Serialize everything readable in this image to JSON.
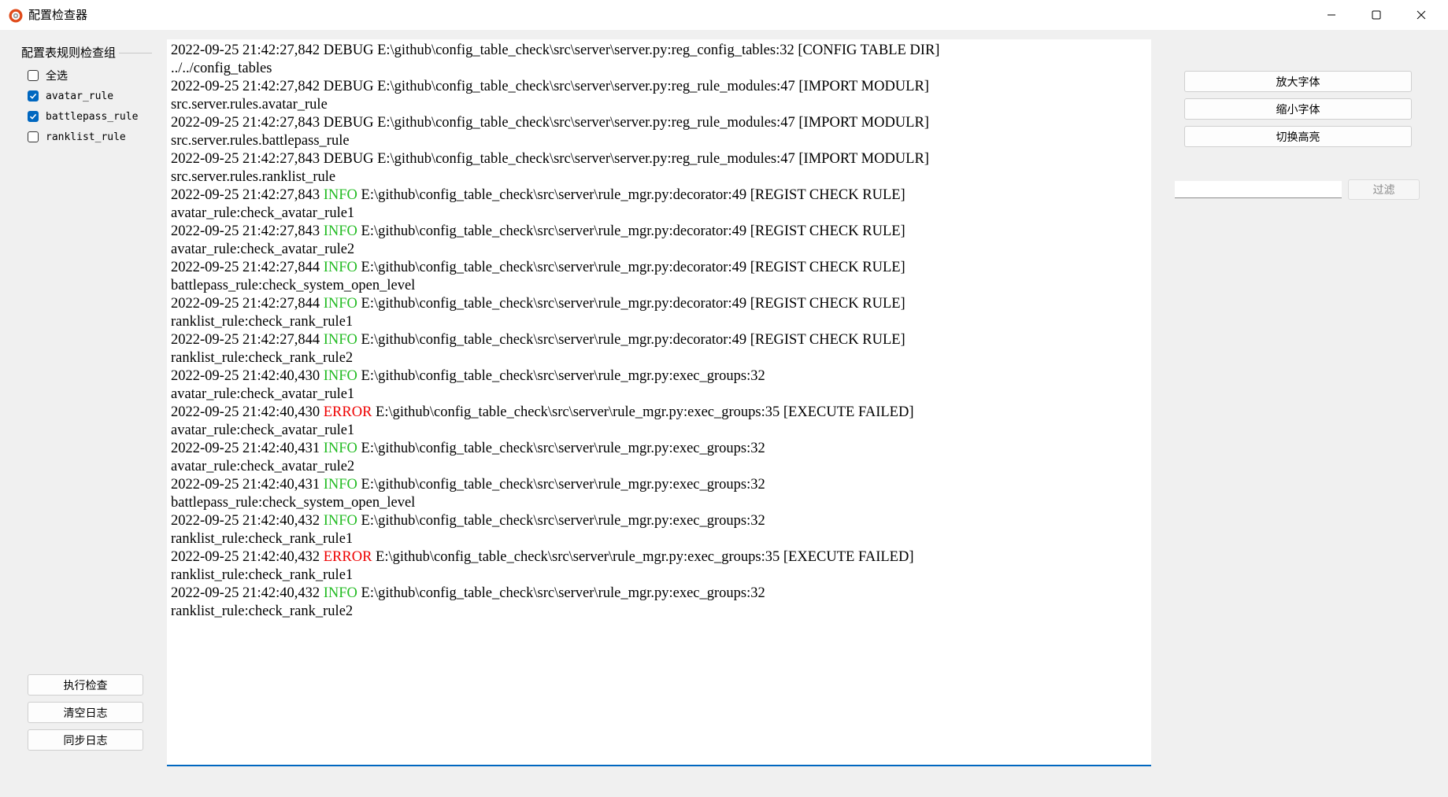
{
  "window": {
    "title": "配置检查器",
    "icon": "gear-icon",
    "controls": {
      "minimize": "minimize-icon",
      "maximize": "maximize-icon",
      "close": "close-icon"
    }
  },
  "group": {
    "title": "配置表规则检查组",
    "items": [
      {
        "label": "全选",
        "checked": false
      },
      {
        "label": "avatar_rule",
        "checked": true
      },
      {
        "label": "battlepass_rule",
        "checked": true
      },
      {
        "label": "ranklist_rule",
        "checked": false
      }
    ]
  },
  "left_buttons": {
    "run": "执行检查",
    "clear": "清空日志",
    "sync": "同步日志"
  },
  "right_buttons": {
    "zoom_in": "放大字体",
    "zoom_out": "缩小字体",
    "toggle_highlight": "切换高亮"
  },
  "filter": {
    "value": "",
    "button": "过滤"
  },
  "colors": {
    "info": "#22bb22",
    "error": "#ee0000",
    "accent": "#0067c0"
  },
  "log": [
    {
      "time": "2022-09-25 21:42:27,842",
      "level": "DEBUG",
      "rest": " E:\\github\\config_table_check\\src\\server\\server.py:reg_config_tables:32 [CONFIG TABLE DIR]",
      "detail": "../../config_tables"
    },
    {
      "time": "2022-09-25 21:42:27,842",
      "level": "DEBUG",
      "rest": " E:\\github\\config_table_check\\src\\server\\server.py:reg_rule_modules:47 [IMPORT MODULR]",
      "detail": "src.server.rules.avatar_rule"
    },
    {
      "time": "2022-09-25 21:42:27,843",
      "level": "DEBUG",
      "rest": " E:\\github\\config_table_check\\src\\server\\server.py:reg_rule_modules:47 [IMPORT MODULR]",
      "detail": "src.server.rules.battlepass_rule"
    },
    {
      "time": "2022-09-25 21:42:27,843",
      "level": "DEBUG",
      "rest": " E:\\github\\config_table_check\\src\\server\\server.py:reg_rule_modules:47 [IMPORT MODULR]",
      "detail": "src.server.rules.ranklist_rule"
    },
    {
      "time": "2022-09-25 21:42:27,843",
      "level": "INFO",
      "rest": " E:\\github\\config_table_check\\src\\server\\rule_mgr.py:decorator:49 [REGIST CHECK RULE]",
      "detail": "avatar_rule:check_avatar_rule1"
    },
    {
      "time": "2022-09-25 21:42:27,843",
      "level": "INFO",
      "rest": " E:\\github\\config_table_check\\src\\server\\rule_mgr.py:decorator:49 [REGIST CHECK RULE]",
      "detail": "avatar_rule:check_avatar_rule2"
    },
    {
      "time": "2022-09-25 21:42:27,844",
      "level": "INFO",
      "rest": " E:\\github\\config_table_check\\src\\server\\rule_mgr.py:decorator:49 [REGIST CHECK RULE]",
      "detail": "battlepass_rule:check_system_open_level"
    },
    {
      "time": "2022-09-25 21:42:27,844",
      "level": "INFO",
      "rest": " E:\\github\\config_table_check\\src\\server\\rule_mgr.py:decorator:49 [REGIST CHECK RULE]",
      "detail": "ranklist_rule:check_rank_rule1"
    },
    {
      "time": "2022-09-25 21:42:27,844",
      "level": "INFO",
      "rest": " E:\\github\\config_table_check\\src\\server\\rule_mgr.py:decorator:49 [REGIST CHECK RULE]",
      "detail": "ranklist_rule:check_rank_rule2"
    },
    {
      "time": "2022-09-25 21:42:40,430",
      "level": "INFO",
      "rest": " E:\\github\\config_table_check\\src\\server\\rule_mgr.py:exec_groups:32",
      "detail": "avatar_rule:check_avatar_rule1"
    },
    {
      "time": "2022-09-25 21:42:40,430",
      "level": "ERROR",
      "rest": " E:\\github\\config_table_check\\src\\server\\rule_mgr.py:exec_groups:35 [EXECUTE FAILED]",
      "detail": "avatar_rule:check_avatar_rule1"
    },
    {
      "time": "2022-09-25 21:42:40,431",
      "level": "INFO",
      "rest": " E:\\github\\config_table_check\\src\\server\\rule_mgr.py:exec_groups:32",
      "detail": "avatar_rule:check_avatar_rule2"
    },
    {
      "time": "2022-09-25 21:42:40,431",
      "level": "INFO",
      "rest": " E:\\github\\config_table_check\\src\\server\\rule_mgr.py:exec_groups:32",
      "detail": "battlepass_rule:check_system_open_level"
    },
    {
      "time": "2022-09-25 21:42:40,432",
      "level": "INFO",
      "rest": " E:\\github\\config_table_check\\src\\server\\rule_mgr.py:exec_groups:32",
      "detail": "ranklist_rule:check_rank_rule1"
    },
    {
      "time": "2022-09-25 21:42:40,432",
      "level": "ERROR",
      "rest": " E:\\github\\config_table_check\\src\\server\\rule_mgr.py:exec_groups:35 [EXECUTE FAILED]",
      "detail": "ranklist_rule:check_rank_rule1"
    },
    {
      "time": "2022-09-25 21:42:40,432",
      "level": "INFO",
      "rest": " E:\\github\\config_table_check\\src\\server\\rule_mgr.py:exec_groups:32",
      "detail": "ranklist_rule:check_rank_rule2"
    }
  ]
}
